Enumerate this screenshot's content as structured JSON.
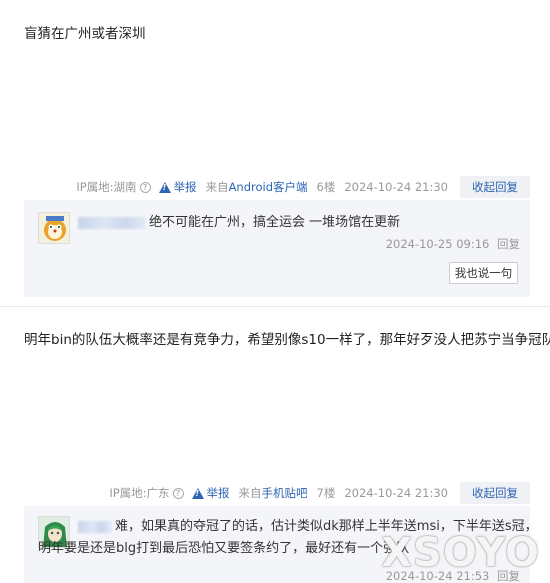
{
  "posts": [
    {
      "text": "盲猜在广州或者深圳",
      "meta": {
        "ip_label": "IP属地:湖南",
        "help_icon": "?",
        "report_label": "举报",
        "source_prefix": "来自",
        "source_client": "Android客户端",
        "floor": "6楼",
        "datetime": "2024-10-24 21:30",
        "reply_button": "收起回复"
      },
      "replies": [
        {
          "text": "绝不可能在广州，搞全运会 一堆场馆在更新",
          "datetime": "2024-10-25 09:16",
          "reply_label": "回复"
        }
      ],
      "say_button": "我也说一句"
    },
    {
      "text": "明年bin的队伍大概率还是有竞争力，希望别像s10一样了，那年好歹没人把苏宁当争冠队伍",
      "meta": {
        "ip_label": "IP属地:广东",
        "help_icon": "?",
        "report_label": "举报",
        "source_prefix": "来自",
        "source_client": "手机贴吧",
        "floor": "7楼",
        "datetime": "2024-10-24 21:30",
        "reply_button": "收起回复"
      },
      "replies": [
        {
          "line1": "难，如果真的夺冠了的话，估计类似dk那样上半年送msi，下半年送s冠，",
          "line2": "明年要是还是blg打到最后恐怕又要签条约了，最好还有一个强队",
          "datetime": "2024-10-24 21:53",
          "reply_label": "回复"
        }
      ]
    }
  ],
  "watermark": "XSOYO"
}
